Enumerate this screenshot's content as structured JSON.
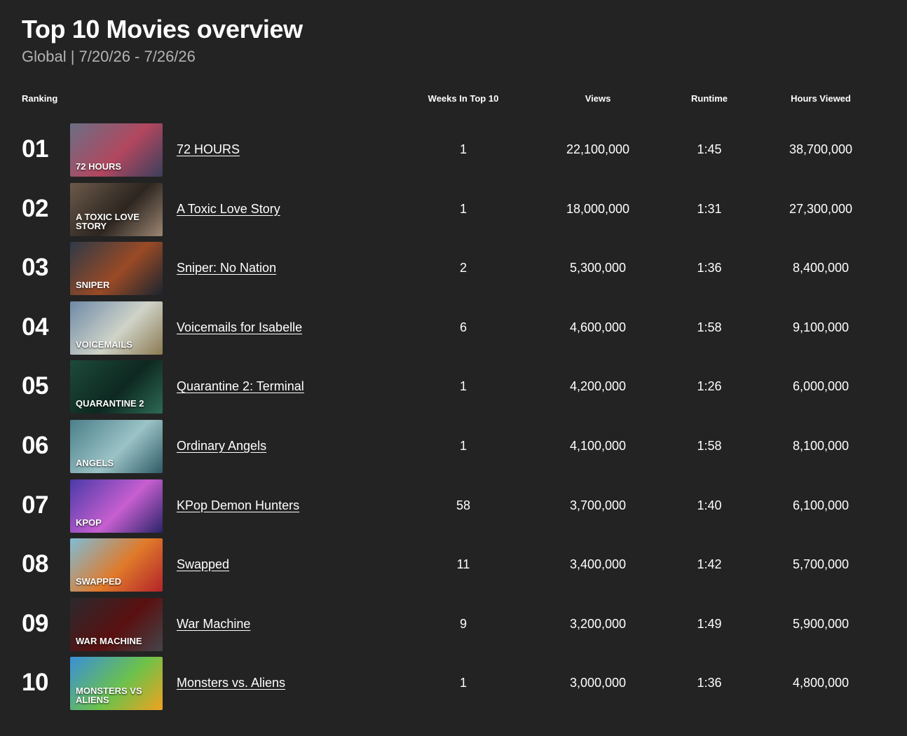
{
  "header": {
    "title": "Top 10 Movies overview",
    "subtitle": "Global | 7/20/26 - 7/26/26"
  },
  "columns": {
    "ranking": "Ranking",
    "weeks": "Weeks In Top 10",
    "views": "Views",
    "runtime": "Runtime",
    "hours": "Hours Viewed"
  },
  "rows": [
    {
      "rank": "01",
      "title": "72 HOURS",
      "thumb_text": "72 HOURS",
      "thumb_colors": [
        "#6a6f84",
        "#b2475f",
        "#3a3f5c"
      ],
      "weeks": "1",
      "views": "22,100,000",
      "runtime": "1:45",
      "hours": "38,700,000"
    },
    {
      "rank": "02",
      "title": "A Toxic Love Story",
      "thumb_text": "A TOXIC LOVE STORY",
      "thumb_colors": [
        "#6b5a4a",
        "#2d2520",
        "#9c8672"
      ],
      "weeks": "1",
      "views": "18,000,000",
      "runtime": "1:31",
      "hours": "27,300,000"
    },
    {
      "rank": "03",
      "title": "Sniper: No Nation",
      "thumb_text": "SNIPER",
      "thumb_colors": [
        "#2e3a48",
        "#9a4a25",
        "#1b2530"
      ],
      "weeks": "2",
      "views": "5,300,000",
      "runtime": "1:36",
      "hours": "8,400,000"
    },
    {
      "rank": "04",
      "title": "Voicemails for Isabelle",
      "thumb_text": "VOICEMAILS",
      "thumb_colors": [
        "#6e8aa8",
        "#cfd3c8",
        "#8c7a52"
      ],
      "weeks": "6",
      "views": "4,600,000",
      "runtime": "1:58",
      "hours": "9,100,000"
    },
    {
      "rank": "05",
      "title": "Quarantine 2: Terminal",
      "thumb_text": "QUARANTINE 2",
      "thumb_colors": [
        "#1d4a3b",
        "#0d2820",
        "#2e6a55"
      ],
      "weeks": "1",
      "views": "4,200,000",
      "runtime": "1:26",
      "hours": "6,000,000"
    },
    {
      "rank": "06",
      "title": "Ordinary Angels",
      "thumb_text": "ANGELS",
      "thumb_colors": [
        "#4a7f8a",
        "#9bc3c6",
        "#2f5a66"
      ],
      "weeks": "1",
      "views": "4,100,000",
      "runtime": "1:58",
      "hours": "8,100,000"
    },
    {
      "rank": "07",
      "title": "KPop Demon Hunters",
      "thumb_text": "KPOP",
      "thumb_colors": [
        "#4a3aa8",
        "#c75fd0",
        "#2a2468"
      ],
      "weeks": "58",
      "views": "3,700,000",
      "runtime": "1:40",
      "hours": "6,100,000"
    },
    {
      "rank": "08",
      "title": "Swapped",
      "thumb_text": "SWAPPED",
      "thumb_colors": [
        "#7fbcd6",
        "#e07a2a",
        "#b3232a"
      ],
      "weeks": "11",
      "views": "3,400,000",
      "runtime": "1:42",
      "hours": "5,700,000"
    },
    {
      "rank": "09",
      "title": "War Machine",
      "thumb_text": "WAR MACHINE",
      "thumb_colors": [
        "#2a2a2e",
        "#5a1010",
        "#44444a"
      ],
      "weeks": "9",
      "views": "3,200,000",
      "runtime": "1:49",
      "hours": "5,900,000"
    },
    {
      "rank": "10",
      "title": "Monsters vs. Aliens",
      "thumb_text": "MONSTERS VS ALIENS",
      "thumb_colors": [
        "#3a8fd8",
        "#6cc24a",
        "#f0a21f"
      ],
      "weeks": "1",
      "views": "3,000,000",
      "runtime": "1:36",
      "hours": "4,800,000"
    }
  ]
}
